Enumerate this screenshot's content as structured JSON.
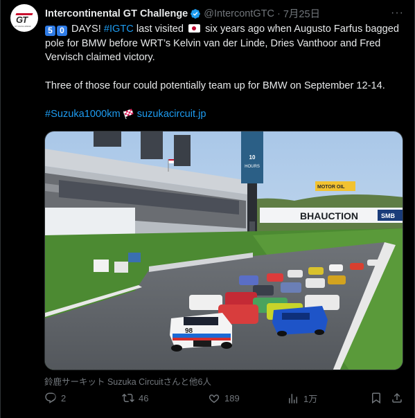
{
  "account": {
    "name": "Intercontinental GT Challenge",
    "handle": "@IntercontGTC",
    "separator": "·",
    "date": "7月25日",
    "avatar_text": "GT",
    "avatar_subtext": "GT CHALLENGE"
  },
  "tweet": {
    "kbd1": "5",
    "kbd2": "0",
    "p1_a": " DAYS! ",
    "p1_tag": "#IGTC",
    "p1_b": " last visited ",
    "p1_c": " six years ago when Augusto Farfus bagged pole for BMW before WRT’s Kelvin van der Linde, Dries Vanthoor and Fred Vervisch claimed victory.",
    "p2": "Three of those four could potentially team up for BMW on September 12-14.",
    "hashtag": "#Suzuka1000km",
    "url": "suzukacircuit.jp"
  },
  "media": {
    "tower_text": "HOURS",
    "tower_num": "10",
    "banner_text": "BHAUCTION",
    "smb_text": "SMB",
    "motor_text": "MOTOR OIL",
    "car_number_1": "98"
  },
  "credit": "鈴鹿サーキット Suzuka Circuitさんと他6人",
  "actions": {
    "replies": "2",
    "reposts": "46",
    "likes": "189",
    "views": "1万"
  },
  "colors": {
    "background": "#000000",
    "text": "#e7e9ea",
    "muted": "#71767b",
    "link": "#1d9bf0",
    "verified": "#1d9bf0"
  }
}
